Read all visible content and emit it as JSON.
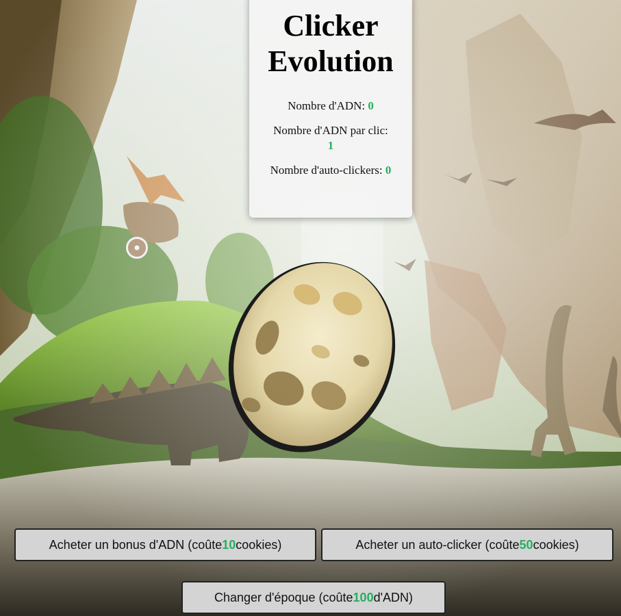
{
  "panel": {
    "title_line1": "Clicker",
    "title_line2": "Evolution",
    "dna_label": "Nombre d'ADN: ",
    "dna_value": "0",
    "per_click_label": "Nombre d'ADN par clic: ",
    "per_click_value": "1",
    "auto_clickers_label": "Nombre d'auto-clickers: ",
    "auto_clickers_value": "0"
  },
  "buttons": {
    "bonus": {
      "prefix": "Acheter un bonus d'ADN (coûte ",
      "cost": "10",
      "suffix": " cookies)"
    },
    "auto_clicker": {
      "prefix": "Acheter un auto-clicker (coûte ",
      "cost": "50",
      "suffix": " cookies)"
    },
    "epoch": {
      "prefix": "Changer d'époque (coûte ",
      "cost": "100",
      "suffix": " d'ADN)"
    }
  },
  "icons": {
    "egg": "dinosaur-egg-icon",
    "cursor": "click-cursor-icon"
  },
  "colors": {
    "accent_value": "#27ae60",
    "panel_background": "#f4f4f4",
    "button_background": "#d4d4d4"
  }
}
